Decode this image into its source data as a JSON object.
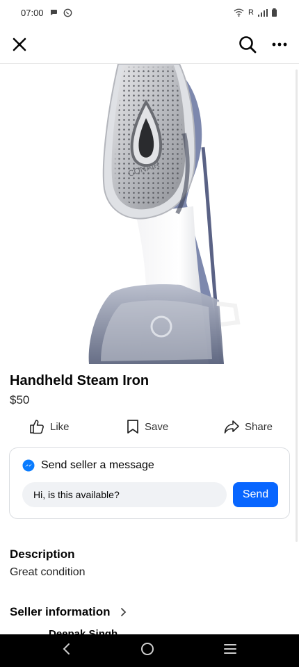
{
  "status": {
    "time": "07:00",
    "carrier": "R"
  },
  "listing": {
    "title": "Handheld Steam Iron",
    "price": "$50",
    "image_brand": "CONAIR"
  },
  "actions": {
    "like": "Like",
    "save": "Save",
    "share": "Share"
  },
  "message": {
    "header": "Send seller a message",
    "input_value": "Hi, is this available?",
    "send_label": "Send"
  },
  "description": {
    "heading": "Description",
    "text": "Great condition"
  },
  "seller": {
    "heading": "Seller information",
    "name": "Deepak Singh"
  },
  "colors": {
    "accent": "#0866ff",
    "messenger": "#0a7cff",
    "nav_bar": "#000000"
  }
}
